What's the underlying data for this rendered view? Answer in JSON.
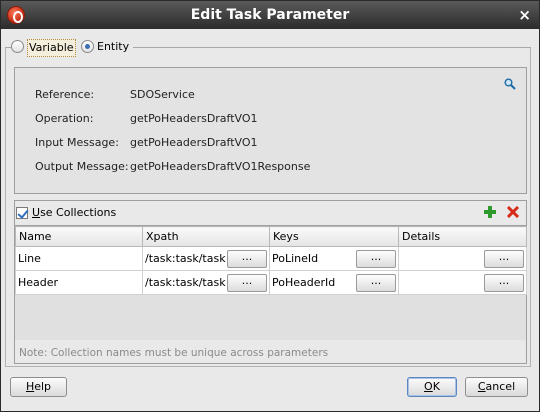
{
  "window": {
    "title": "Edit Task Parameter",
    "close_glyph": "×"
  },
  "mode": {
    "variable_label": "Variable",
    "entity_label": "Entity",
    "selected": "Entity"
  },
  "info": {
    "reference_label": "Reference:",
    "reference_value": "SDOService",
    "operation_label": "Operation:",
    "operation_value": "getPoHeadersDraftVO1",
    "input_label": "Input Message:",
    "input_value": "getPoHeadersDraftVO1",
    "output_label": "Output Message:",
    "output_value": "getPoHeadersDraftVO1Response"
  },
  "collections": {
    "use_label_first": "U",
    "use_label_rest": "se Collections",
    "checked": true,
    "columns": [
      "Name",
      "Xpath",
      "Keys",
      "Details"
    ],
    "rows": [
      {
        "name": "Line",
        "xpath": "/task:task/task",
        "keys": "PoLineId",
        "details": ""
      },
      {
        "name": "Header",
        "xpath": "/task:task/task",
        "keys": "PoHeaderId",
        "details": ""
      }
    ],
    "ellipsis": "...",
    "note": "Note: Collection names must be unique across parameters"
  },
  "buttons": {
    "help_first": "H",
    "help_rest": "elp",
    "ok_first": "O",
    "ok_rest": "K",
    "cancel_first": "C",
    "cancel_rest": "ancel"
  },
  "icons": {
    "app": "oracle-app-icon",
    "search": "search-icon",
    "add": "plus-icon",
    "delete": "delete-icon",
    "colors": {
      "add": "#2e9a2e",
      "delete": "#d62a1a",
      "accent": "#3a6fb0"
    }
  }
}
